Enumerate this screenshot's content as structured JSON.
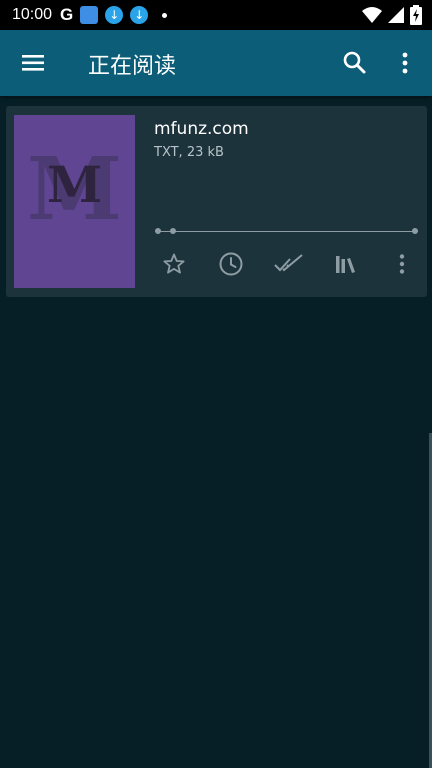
{
  "status_bar": {
    "time": "10:00",
    "google_glyph": "G",
    "icons": [
      "google-icon",
      "app-notification-icon",
      "download-icon",
      "download-icon",
      "dot-icon",
      "wifi-icon",
      "signal-icon",
      "battery-charging-icon"
    ]
  },
  "app_bar": {
    "title": "正在阅读",
    "menu_icon": "menu-icon",
    "search_icon": "search-icon",
    "more_icon": "more-vert-icon"
  },
  "book": {
    "title": "mfunz.com",
    "meta": "TXT, 23 kB",
    "cover_letter": "M",
    "cover_color": "#5f4592",
    "progress_fraction": 0.06,
    "actions": [
      {
        "name": "favorite",
        "icon": "star-outline-icon"
      },
      {
        "name": "recent",
        "icon": "clock-icon"
      },
      {
        "name": "mark-read",
        "icon": "double-check-icon"
      },
      {
        "name": "library",
        "icon": "library-icon"
      },
      {
        "name": "more",
        "icon": "more-vert-icon"
      }
    ]
  },
  "colors": {
    "app_bar": "#0c5e78",
    "background": "#061f27",
    "card": "#1d333b",
    "icon": "#8e9da3"
  }
}
